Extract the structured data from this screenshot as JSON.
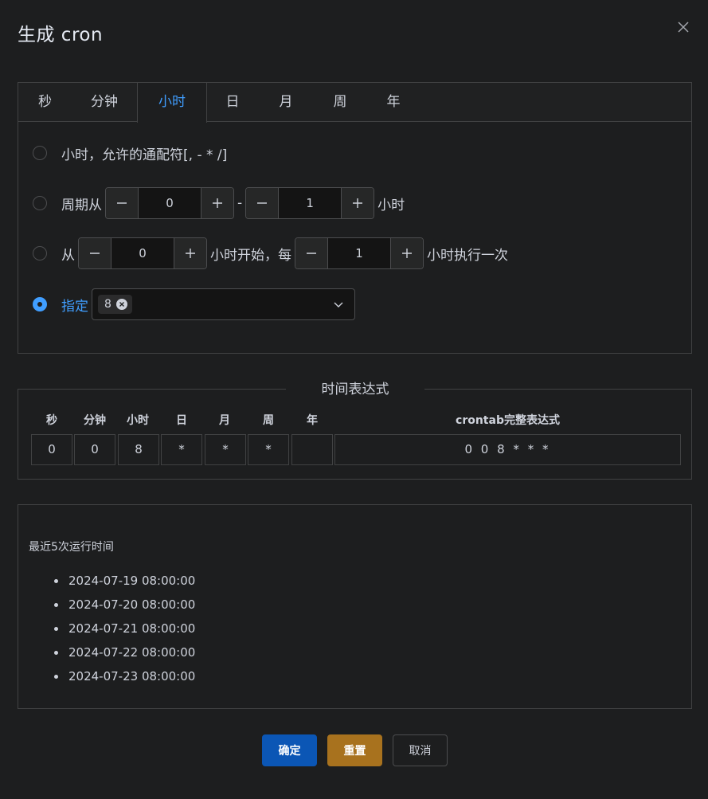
{
  "dialog": {
    "title": "生成 cron"
  },
  "tabs": [
    {
      "label": "秒"
    },
    {
      "label": "分钟"
    },
    {
      "label": "小时",
      "active": true
    },
    {
      "label": "日"
    },
    {
      "label": "月"
    },
    {
      "label": "周"
    },
    {
      "label": "年"
    }
  ],
  "hour_panel": {
    "option_every": {
      "label": "小时，允许的通配符[, - * /]"
    },
    "option_cycle": {
      "prefix": "周期从",
      "from_value": "0",
      "separator": "-",
      "to_value": "1",
      "suffix": "小时"
    },
    "option_interval": {
      "prefix": "从",
      "start_value": "0",
      "middle": "小时开始，每",
      "step_value": "1",
      "suffix": "小时执行一次"
    },
    "option_specify": {
      "label": "指定",
      "selected_tag": "8",
      "checked": true
    }
  },
  "expression": {
    "legend": "时间表达式",
    "headers": [
      "秒",
      "分钟",
      "小时",
      "日",
      "月",
      "周",
      "年",
      "crontab完整表达式"
    ],
    "values": [
      "0",
      "0",
      "8",
      "*",
      "*",
      "*",
      "",
      "0 0 8 * * *"
    ]
  },
  "run_times": {
    "title": "最近5次运行时间",
    "items": [
      "2024-07-19 08:00:00",
      "2024-07-20 08:00:00",
      "2024-07-21 08:00:00",
      "2024-07-22 08:00:00",
      "2024-07-23 08:00:00"
    ]
  },
  "footer": {
    "confirm_label": "确定",
    "reset_label": "重置",
    "cancel_label": "取消"
  },
  "colors": {
    "background": "#1d1e1f",
    "accent": "#409eff",
    "confirm": "#0b56b5",
    "reset": "#a8721e",
    "border": "#414243"
  }
}
